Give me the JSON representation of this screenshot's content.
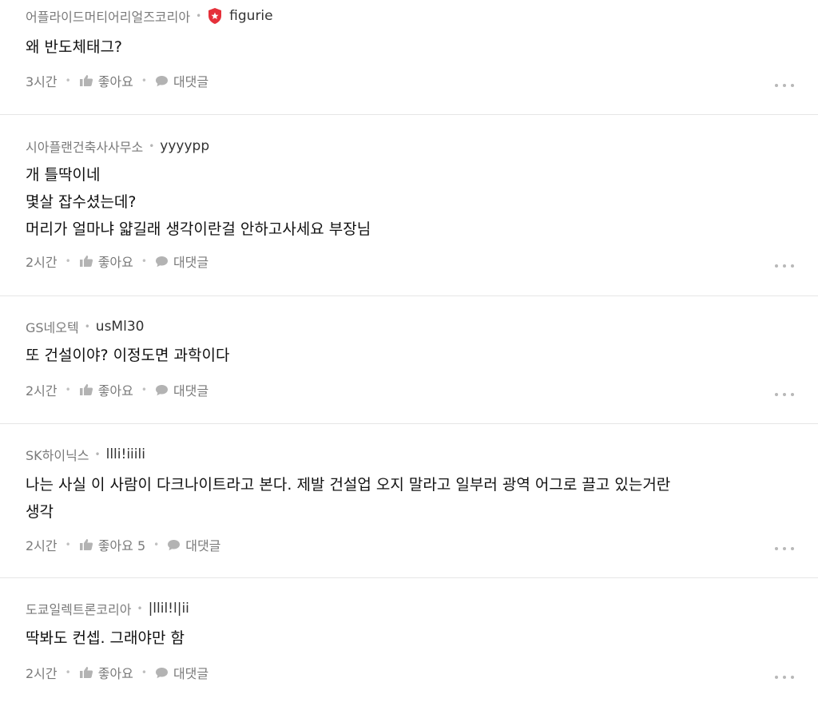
{
  "comments": [
    {
      "company": "어플라이드머티어리얼즈코리아",
      "nickname": "figurie",
      "has_badge": true,
      "lines": [
        "왜 반도체태그?"
      ],
      "time": "3시간",
      "like_label": "좋아요",
      "reply_label": "대댓글"
    },
    {
      "company": "시아플랜건축사사무소",
      "nickname": "yyyypp",
      "has_badge": false,
      "lines": [
        "개 틀딱이네",
        "몇살 잡수셨는데?",
        "머리가 얼마냐 얇길래 생각이란걸 안하고사세요 부장님"
      ],
      "time": "2시간",
      "like_label": "좋아요",
      "reply_label": "대댓글"
    },
    {
      "company": "GS네오텍",
      "nickname": "usMl30",
      "has_badge": false,
      "lines": [
        "또 건설이야? 이정도면 과학이다"
      ],
      "time": "2시간",
      "like_label": "좋아요",
      "reply_label": "대댓글"
    },
    {
      "company": "SK하이닉스",
      "nickname": "llli!iiili",
      "has_badge": false,
      "lines": [
        "나는 사실 이 사람이 다크나이트라고 본다. 제발 건설업 오지 말라고 일부러 광역 어그로 끌고 있는거란",
        "생각"
      ],
      "time": "2시간",
      "like_label": "좋아요 5",
      "reply_label": "대댓글"
    },
    {
      "company": "도쿄일렉트론코리아",
      "nickname": "|llil!l|ii",
      "has_badge": false,
      "lines": [
        "딱봐도 컨셉. 그래야만 함"
      ],
      "time": "2시간",
      "like_label": "좋아요",
      "reply_label": "대댓글"
    }
  ],
  "icons": {
    "badge": "shield-badge-icon",
    "like": "thumbs-up-icon",
    "reply": "speech-bubble-icon",
    "more": "more-dots-icon"
  },
  "colors": {
    "badge_red": "#e5303a",
    "meta_gray": "#7a7a7a",
    "divider": "#e6e6e6"
  }
}
